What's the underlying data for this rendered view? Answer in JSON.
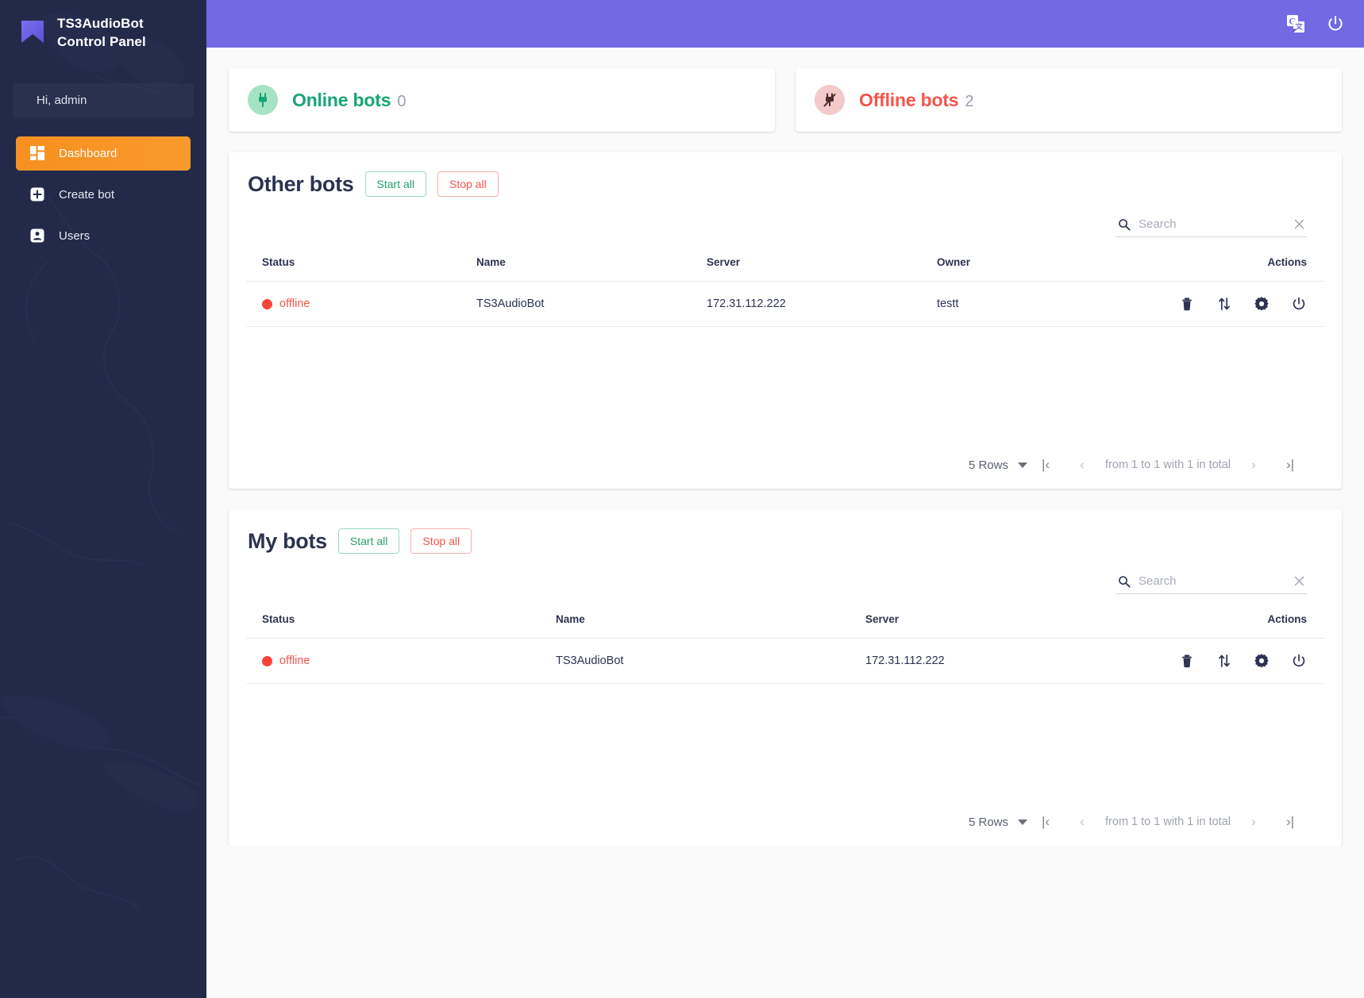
{
  "brand": {
    "line1": "TS3AudioBot",
    "line2": "Control Panel",
    "logo_icon": "bookmark-logo-icon",
    "logo_color": "#6c5ce7"
  },
  "sidebar": {
    "greeting": "Hi, admin",
    "items": [
      {
        "label": "Dashboard",
        "icon": "dashboard-grid-icon",
        "active": true
      },
      {
        "label": "Create bot",
        "icon": "plus-square-icon",
        "active": false
      },
      {
        "label": "Users",
        "icon": "user-square-icon",
        "active": false
      }
    ],
    "background_color": "#232a49",
    "active_color": "#f7921e"
  },
  "topbar": {
    "background_color": "#7269e3",
    "translate_icon": "google-translate-icon",
    "power_icon": "power-icon"
  },
  "stats": [
    {
      "label": "Online bots",
      "count": "0",
      "icon": "plug-icon",
      "color": "#17a673",
      "bubble_color": "#a6e3c4"
    },
    {
      "label": "Offline bots",
      "count": "2",
      "icon": "plug-disabled-icon",
      "color": "#f8544c",
      "bubble_color": "#f3c9c9"
    }
  ],
  "panels": [
    {
      "title": "Other bots",
      "start_label": "Start all",
      "stop_label": "Stop all",
      "search": {
        "value": "",
        "placeholder": "Search",
        "icon": "search-icon",
        "clear_icon": "close-icon"
      },
      "columns": [
        "Status",
        "Name",
        "Server",
        "Owner",
        "Actions"
      ],
      "rows": [
        {
          "status": "offline",
          "name": "TS3AudioBot",
          "server": "172.31.112.222",
          "owner": "testt"
        }
      ],
      "actions": [
        "delete-icon",
        "transfer-icon",
        "settings-gear-icon",
        "power-icon"
      ],
      "pager": {
        "rows_per_page": "5 Rows",
        "first_label": "|‹",
        "prev_label": "‹",
        "info": "from 1 to 1 with 1 in total",
        "next_label": "›",
        "last_label": "›|"
      }
    },
    {
      "title": "My bots",
      "start_label": "Start all",
      "stop_label": "Stop all",
      "search": {
        "value": "",
        "placeholder": "Search",
        "icon": "search-icon",
        "clear_icon": "close-icon"
      },
      "columns": [
        "Status",
        "Name",
        "Server",
        "Actions"
      ],
      "rows": [
        {
          "status": "offline",
          "name": "TS3AudioBot",
          "server": "172.31.112.222"
        }
      ],
      "actions": [
        "delete-icon",
        "transfer-icon",
        "settings-gear-icon",
        "power-icon"
      ],
      "pager": {
        "rows_per_page": "5 Rows",
        "first_label": "|‹",
        "prev_label": "‹",
        "info": "from 1 to 1 with 1 in total",
        "next_label": "›",
        "last_label": "›|"
      }
    }
  ]
}
